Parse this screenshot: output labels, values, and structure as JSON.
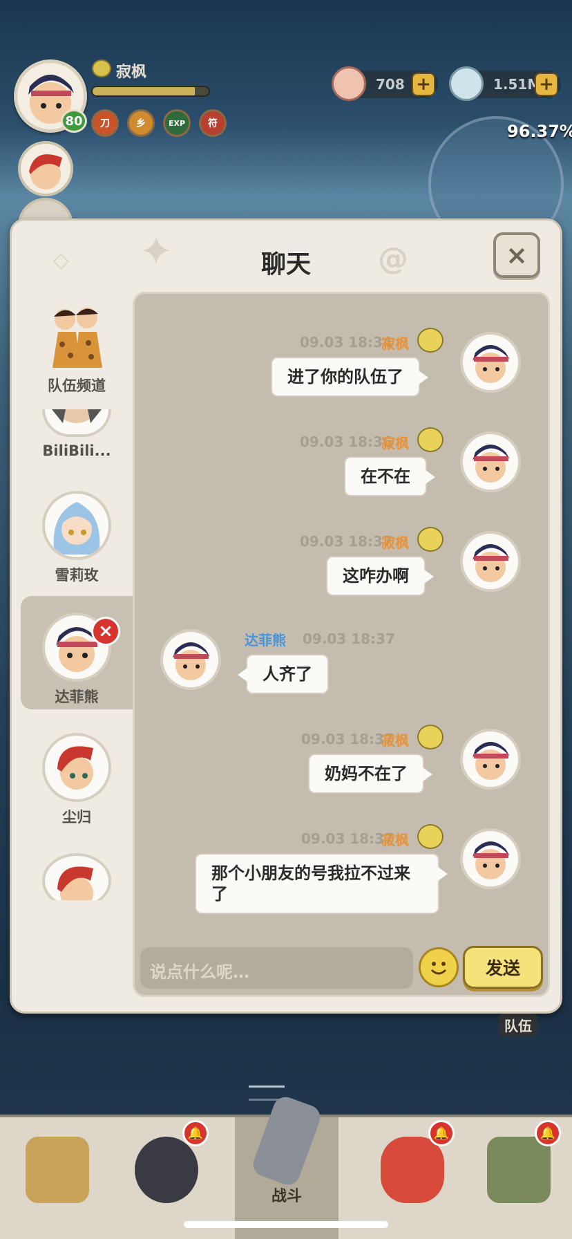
{
  "hud": {
    "player_name": "寂枫",
    "level": "80",
    "exp_progress": 0.88,
    "buffs": [
      "刀",
      "乡",
      "EXP",
      "符"
    ],
    "currency_shells": "708",
    "currency_crystal": "1.51M",
    "map_progress": "96.37%"
  },
  "panel": {
    "title": "聊天",
    "close_icon": "×"
  },
  "sidebar": {
    "items": [
      {
        "label": "队伍频道"
      },
      {
        "label": "BiliBili..."
      },
      {
        "label": "雪莉玫"
      },
      {
        "label": "达菲熊"
      },
      {
        "label": "尘归"
      },
      {
        "label": ""
      }
    ]
  },
  "messages": [
    {
      "side": "right",
      "name": "寂枫",
      "time": "09.03 18:34",
      "text": "进了你的队伍了"
    },
    {
      "side": "right",
      "name": "寂枫",
      "time": "09.03 18:36",
      "text": "在不在"
    },
    {
      "side": "right",
      "name": "寂枫",
      "time": "09.03 18:37",
      "text": "这咋办啊"
    },
    {
      "side": "left",
      "name": "达菲熊",
      "time": "09.03 18:37",
      "text": "人齐了"
    },
    {
      "side": "right",
      "name": "寂枫",
      "time": "09.03 18:37",
      "text": "奶妈不在了"
    },
    {
      "side": "right",
      "name": "寂枫",
      "time": "09.03 18:37",
      "text": "那个小朋友的号我拉不过来了"
    }
  ],
  "input": {
    "placeholder": "说点什么呢…"
  },
  "send_label": "发送",
  "team_tag": "队伍",
  "bottom_nav": {
    "items": [
      {
        "label": ""
      },
      {
        "label": ""
      },
      {
        "label": "战斗"
      },
      {
        "label": ""
      },
      {
        "label": ""
      }
    ]
  },
  "colors": {
    "my_name": "#e8923a",
    "other_name": "#4a94d8",
    "send_button": "#f6e27a"
  }
}
